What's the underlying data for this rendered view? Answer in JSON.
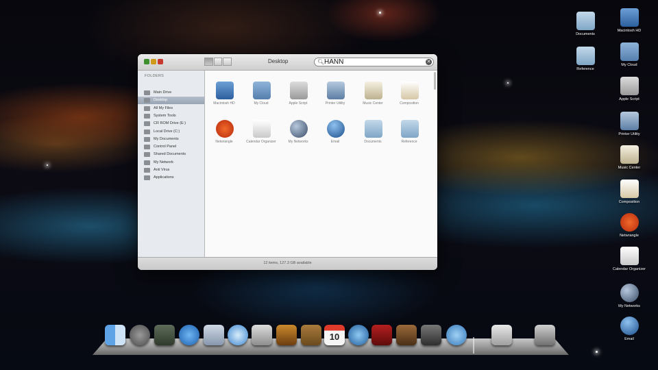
{
  "window": {
    "title": "Desktop",
    "search_value": "HANN",
    "status": "12 items, 127.3 GB available"
  },
  "sidebar": {
    "header": "FOLDERS",
    "items": [
      {
        "label": "Main Drive",
        "selected": false
      },
      {
        "label": "Desktop",
        "selected": true
      },
      {
        "label": "All My Files",
        "selected": false
      },
      {
        "label": "System Tools",
        "selected": false
      },
      {
        "label": "CR ROM Drive (E:)",
        "selected": false
      },
      {
        "label": "Local Drive (C:)",
        "selected": false
      },
      {
        "label": "My Documents",
        "selected": false
      },
      {
        "label": "Control Panel",
        "selected": false
      },
      {
        "label": "Shared Documents",
        "selected": false
      },
      {
        "label": "My Network",
        "selected": false
      },
      {
        "label": "Anti Virus",
        "selected": false
      },
      {
        "label": "Applications",
        "selected": false
      }
    ]
  },
  "content": {
    "items": [
      {
        "label": "Macintosh HD",
        "icon": "hard-drive-icon"
      },
      {
        "label": "My Cloud",
        "icon": "cloud-drive-icon"
      },
      {
        "label": "Apple Script",
        "icon": "script-icon"
      },
      {
        "label": "Printer Utility",
        "icon": "printer-icon"
      },
      {
        "label": "Music Center",
        "icon": "music-icon"
      },
      {
        "label": "Composition",
        "icon": "composition-icon"
      },
      {
        "label": "Netwrangle",
        "icon": "netwrangle-icon"
      },
      {
        "label": "Calendar Organizer",
        "icon": "calendar-icon"
      },
      {
        "label": "My Networks",
        "icon": "globe-icon"
      },
      {
        "label": "Email",
        "icon": "email-icon"
      },
      {
        "label": "Documents",
        "icon": "folder-icon"
      },
      {
        "label": "Reference",
        "icon": "folder-icon"
      }
    ]
  },
  "desktop_icons": [
    {
      "label": "Documents",
      "icon": "folder-icon"
    },
    {
      "label": "Macintosh HD",
      "icon": "hard-drive-icon"
    },
    {
      "label": "Reference",
      "icon": "folder-icon"
    },
    {
      "label": "My Cloud",
      "icon": "cloud-drive-icon"
    },
    {
      "label": "Apple Script",
      "icon": "script-icon"
    },
    {
      "label": "Printer Utility",
      "icon": "printer-icon"
    },
    {
      "label": "Music Center",
      "icon": "music-icon"
    },
    {
      "label": "Composition",
      "icon": "composition-icon"
    },
    {
      "label": "Netwrangle",
      "icon": "netwrangle-icon"
    },
    {
      "label": "Calendar Organizer",
      "icon": "calendar-icon"
    },
    {
      "label": "My Networks",
      "icon": "globe-icon"
    },
    {
      "label": "Email",
      "icon": "email-icon"
    }
  ],
  "dock": {
    "calendar_day": "10",
    "items": [
      "finder-icon",
      "rocket-icon",
      "dashboard-icon",
      "app-store-icon",
      "photo-icon",
      "safari-icon",
      "facetime-camera-icon",
      "guitar-icon",
      "address-book-icon",
      "calendar-icon",
      "music-icon",
      "photo-booth-icon",
      "iphoto-icon",
      "image-capture-icon",
      "video-chat-icon",
      "applications-stack-icon",
      "trash-icon"
    ]
  },
  "colors": {
    "selection": "#98a4b3",
    "window_bg": "#f3f3f3"
  }
}
